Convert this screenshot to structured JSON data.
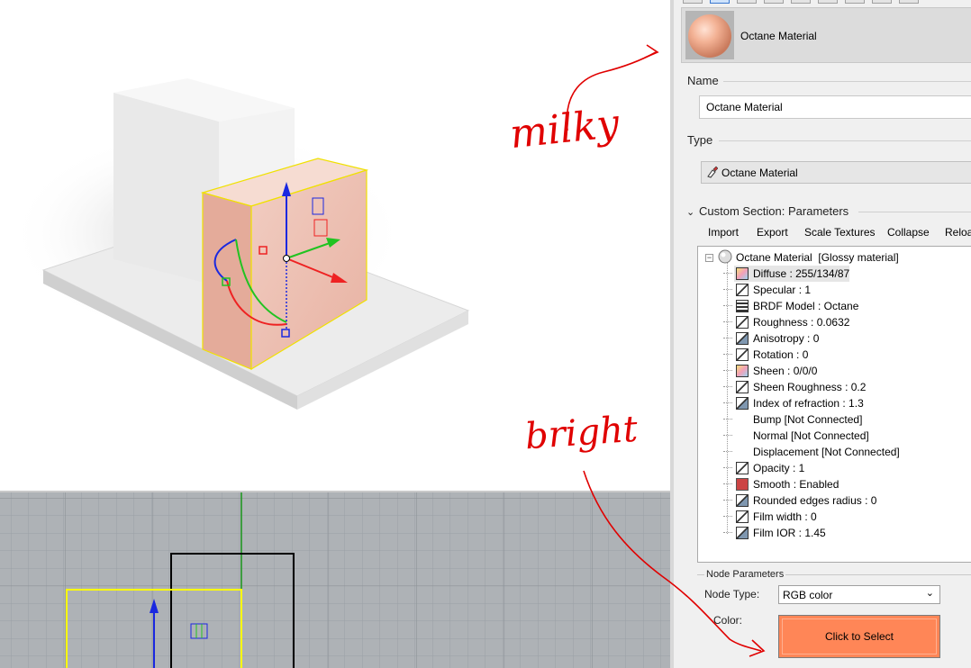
{
  "material": {
    "header_title": "Octane Material",
    "name_label": "Name",
    "name_value": "Octane Material",
    "type_label": "Type",
    "type_value": "Octane Material"
  },
  "custom_section": {
    "title": "Custom Section: Parameters",
    "actions": [
      "Import",
      "Export",
      "Scale Textures",
      "Collapse",
      "Reload"
    ]
  },
  "tree": {
    "root": "Octane Material",
    "root_suffix": "[Glossy material]",
    "items": [
      {
        "label": "Diffuse : 255/134/87",
        "icon": "gradient-icon"
      },
      {
        "label": "Specular : 1",
        "icon": "float-icon"
      },
      {
        "label": "BRDF Model : Octane",
        "icon": "enum-icon"
      },
      {
        "label": "Roughness : 0.0632",
        "icon": "float-icon"
      },
      {
        "label": "Anisotropy : 0",
        "icon": "curve-icon"
      },
      {
        "label": "Rotation : 0",
        "icon": "float-icon"
      },
      {
        "label": "Sheen : 0/0/0",
        "icon": "gradient-icon"
      },
      {
        "label": "Sheen Roughness : 0.2",
        "icon": "float-icon"
      },
      {
        "label": "Index of refraction : 1.3",
        "icon": "curve-icon"
      },
      {
        "label": "Bump  [Not Connected]",
        "icon": ""
      },
      {
        "label": "Normal  [Not Connected]",
        "icon": ""
      },
      {
        "label": "Displacement  [Not Connected]",
        "icon": ""
      },
      {
        "label": "Opacity : 1",
        "icon": "float-icon"
      },
      {
        "label": "Smooth : Enabled",
        "icon": "toggle-icon"
      },
      {
        "label": "Rounded edges radius : 0",
        "icon": "curve-icon"
      },
      {
        "label": "Film width : 0",
        "icon": "float-icon"
      },
      {
        "label": "Film IOR : 1.45",
        "icon": "curve-icon"
      }
    ]
  },
  "node_params": {
    "title": "Node Parameters",
    "node_type_label": "Node Type:",
    "node_type_value": "RGB color",
    "color_label": "Color:",
    "color_button": "Click to Select",
    "color_hex": "#ff8657"
  },
  "annotations": {
    "milky": "milky",
    "bright": "bright",
    "ink_color": "#e00000"
  }
}
